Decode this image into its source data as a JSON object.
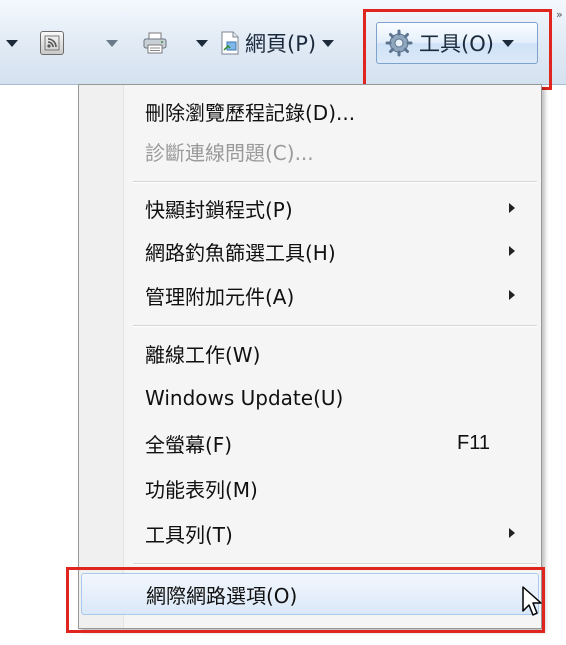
{
  "toolbar": {
    "feeds_icon": "rss-icon",
    "print_icon": "printer-icon",
    "page_label": "網頁(P)",
    "tools_label": "工具(O)",
    "overflow": "»"
  },
  "menu": {
    "items": [
      {
        "label": "刪除瀏覽歷程記錄(D)...",
        "enabled": true
      },
      {
        "label": "診斷連線問題(C)...",
        "enabled": false
      },
      {
        "label": "快顯封鎖程式(P)",
        "submenu": true
      },
      {
        "label": "網路釣魚篩選工具(H)",
        "submenu": true
      },
      {
        "label": "管理附加元件(A)",
        "submenu": true
      },
      {
        "label": "離線工作(W)"
      },
      {
        "label": "Windows Update(U)"
      },
      {
        "label": "全螢幕(F)",
        "shortcut": "F11"
      },
      {
        "label": "功能表列(M)"
      },
      {
        "label": "工具列(T)",
        "submenu": true
      },
      {
        "label": "網際網路選項(O)",
        "hovered": true
      }
    ]
  },
  "colors": {
    "highlight_border": "#e0241e",
    "hover_border": "#a8c8ec"
  }
}
